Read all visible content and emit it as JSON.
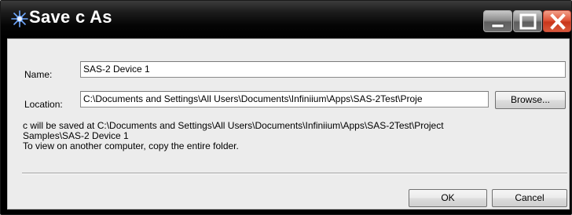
{
  "window": {
    "title": "Save c As"
  },
  "title_controls": {
    "minimize_icon": "minimize-icon",
    "maximize_icon": "maximize-icon",
    "close_icon": "close-icon"
  },
  "form": {
    "name_label": "Name:",
    "name_value": "SAS-2 Device 1",
    "location_label": "Location:",
    "location_value": "C:\\Documents and Settings\\All Users\\Documents\\Infiniium\\Apps\\SAS-2Test\\Proje",
    "browse_label": "Browse..."
  },
  "info": {
    "line1": "c will be saved at C:\\Documents and Settings\\All Users\\Documents\\Infiniium\\Apps\\SAS-2Test\\Project",
    "line2": "Samples\\SAS-2 Device 1",
    "line3": "To view on another computer, copy the entire folder."
  },
  "buttons": {
    "ok_label": "OK",
    "cancel_label": "Cancel"
  },
  "colors": {
    "titlebar": "#000000",
    "client_bg": "#ececec",
    "close_button": "#d9472b"
  }
}
